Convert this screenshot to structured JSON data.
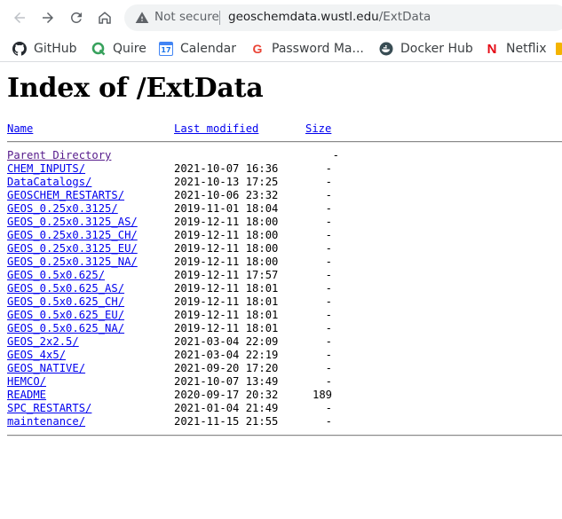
{
  "browser": {
    "security_label": "Not secure",
    "url_host": "geoschemdata.wustl.edu",
    "url_path": "/ExtData",
    "bookmarks": [
      {
        "label": "GitHub",
        "icon": "github-icon"
      },
      {
        "label": "Quire",
        "icon": "quire-icon"
      },
      {
        "label": "Calendar",
        "icon": "calendar-icon",
        "icon_text": "17"
      },
      {
        "label": "Password Ma...",
        "icon": "google-icon",
        "icon_text": "G"
      },
      {
        "label": "Docker Hub",
        "icon": "docker-icon"
      },
      {
        "label": "Netflix",
        "icon": "netflix-icon",
        "icon_text": "N"
      }
    ]
  },
  "page": {
    "title": "Index of /ExtData",
    "columns": {
      "name": "Name",
      "modified": "Last modified",
      "size": "Size"
    },
    "parent": {
      "label": "Parent Directory",
      "size": "-"
    },
    "entries": [
      {
        "name": "CHEM_INPUTS/",
        "modified": "2021-10-07 16:36",
        "size": "-"
      },
      {
        "name": "DataCatalogs/",
        "modified": "2021-10-13 17:25",
        "size": "-"
      },
      {
        "name": "GEOSCHEM_RESTARTS/",
        "modified": "2021-10-06 23:32",
        "size": "-"
      },
      {
        "name": "GEOS_0.25x0.3125/",
        "modified": "2019-11-01 18:04",
        "size": "-"
      },
      {
        "name": "GEOS_0.25x0.3125_AS/",
        "modified": "2019-12-11 18:00",
        "size": "-"
      },
      {
        "name": "GEOS_0.25x0.3125_CH/",
        "modified": "2019-12-11 18:00",
        "size": "-"
      },
      {
        "name": "GEOS_0.25x0.3125_EU/",
        "modified": "2019-12-11 18:00",
        "size": "-"
      },
      {
        "name": "GEOS_0.25x0.3125_NA/",
        "modified": "2019-12-11 18:00",
        "size": "-"
      },
      {
        "name": "GEOS_0.5x0.625/",
        "modified": "2019-12-11 17:57",
        "size": "-"
      },
      {
        "name": "GEOS_0.5x0.625_AS/",
        "modified": "2019-12-11 18:01",
        "size": "-"
      },
      {
        "name": "GEOS_0.5x0.625_CH/",
        "modified": "2019-12-11 18:01",
        "size": "-"
      },
      {
        "name": "GEOS_0.5x0.625_EU/",
        "modified": "2019-12-11 18:01",
        "size": "-"
      },
      {
        "name": "GEOS_0.5x0.625_NA/",
        "modified": "2019-12-11 18:01",
        "size": "-"
      },
      {
        "name": "GEOS_2x2.5/",
        "modified": "2021-03-04 22:09",
        "size": "-"
      },
      {
        "name": "GEOS_4x5/",
        "modified": "2021-03-04 22:19",
        "size": "-"
      },
      {
        "name": "GEOS_NATIVE/",
        "modified": "2021-09-20 17:20",
        "size": "-"
      },
      {
        "name": "HEMCO/",
        "modified": "2021-10-07 13:49",
        "size": "-"
      },
      {
        "name": "README",
        "modified": "2020-09-17 20:32",
        "size": "189"
      },
      {
        "name": "SPC_RESTARTS/",
        "modified": "2021-01-04 21:49",
        "size": "-"
      },
      {
        "name": "maintenance/",
        "modified": "2021-11-15 21:55",
        "size": "-"
      }
    ]
  }
}
